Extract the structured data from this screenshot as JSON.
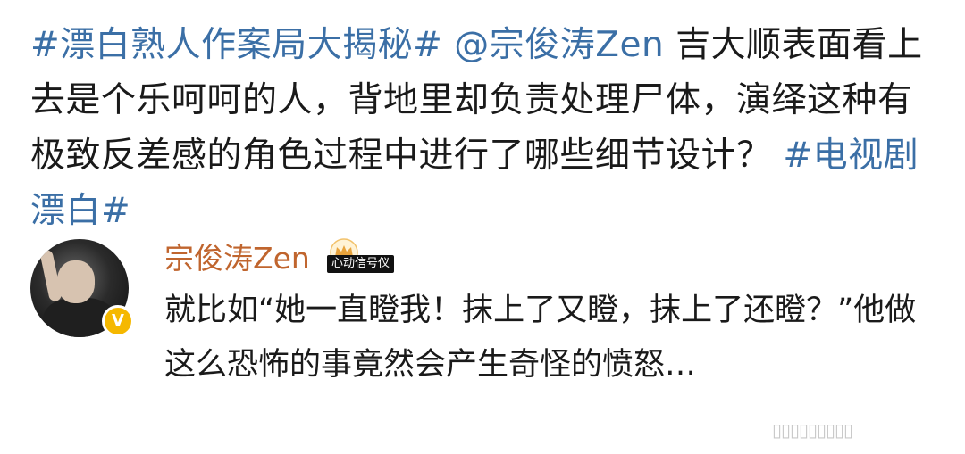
{
  "post": {
    "hashtag_1": "#漂白熟人作案局大揭秘#",
    "mention": "@宗俊涛Zen",
    "body": " 吉大顺表面看上去是个乐呵呵的人，背地里却负责处理尸体，演绎这种有极致反差感的角色过程中进行了哪些细节设计？",
    "hashtag_2": "#电视剧漂白#"
  },
  "reply": {
    "username": "宗俊涛Zen",
    "badge_label": "心动信号仪",
    "verified_mark": "V",
    "text": "就比如“她一直瞪我！抹上了又瞪，抹上了还瞪？”他做这么恐怖的事竟然会产生奇怪的愤怒…"
  },
  "colors": {
    "link": "#3b6fa6",
    "username": "#c0652e",
    "verified": "#f5b800"
  }
}
